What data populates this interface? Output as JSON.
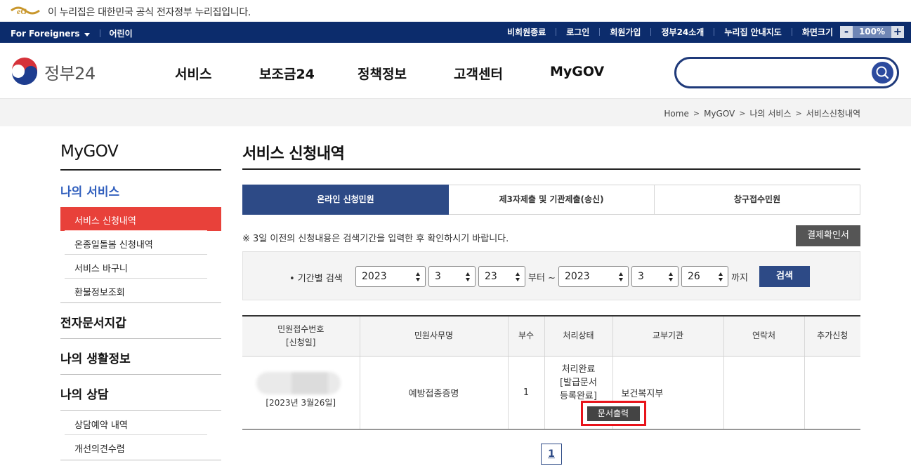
{
  "notice": {
    "text": "이 누리집은 대한민국 공식 전자정부 누리집입니다."
  },
  "utilbar": {
    "foreigners": "For Foreigners",
    "kids": "어린이",
    "links": [
      "비회원종료",
      "로그인",
      "회원가입",
      "정부24소개",
      "누리집 안내지도",
      "화면크기"
    ],
    "zoom_minus": "-",
    "zoom_value": "100%",
    "zoom_plus": "+"
  },
  "header": {
    "logo_text": "정부24",
    "gnb": [
      "서비스",
      "보조금24",
      "정책정보",
      "고객센터",
      "MyGOV"
    ],
    "search_placeholder": ""
  },
  "breadcrumb": [
    "Home",
    "MyGOV",
    "나의 서비스",
    "서비스신청내역"
  ],
  "sidebar": {
    "title": "MyGOV",
    "section1": "나의 서비스",
    "section1_items": [
      "서비스 신청내역",
      "온종일돌봄 신청내역",
      "서비스 바구니",
      "환불정보조회"
    ],
    "sections": [
      "전자문서지갑",
      "나의 생활정보",
      "나의 상담"
    ],
    "section4_items": [
      "상담예약 내역",
      "개선의견수렴"
    ]
  },
  "main": {
    "title": "서비스 신청내역",
    "tabs": [
      "온라인 신청민원",
      "제3자제출 및 기관제출(송신)",
      "창구접수민원"
    ],
    "note": "※ 3일 이전의 신청내용은 검색기간을 입력한 후 확인하시기 바랍니다.",
    "receipt_button": "결제확인서",
    "search": {
      "label": "• 기간별 검색",
      "from_year": "2023",
      "from_month": "3",
      "from_day": "23",
      "from_text": "부터 ~",
      "to_year": "2023",
      "to_month": "3",
      "to_day": "26",
      "to_text": "까지",
      "button": "검색"
    },
    "table": {
      "headers": [
        "민원접수번호\n[신청일]",
        "민원사무명",
        "부수",
        "처리상태",
        "교부기관",
        "연락처",
        "추가신청"
      ],
      "header_line1": "민원접수번호",
      "header_line2": "[신청일]",
      "rows": [
        {
          "date": "[2023년 3월26일]",
          "name": "예방접종증명",
          "copies": "1",
          "status1": "처리완료",
          "status2": "[발급문서",
          "status3": "등록완료]",
          "print_button": "문서출력",
          "agency": "보건복지부",
          "contact": "",
          "extra": ""
        }
      ]
    },
    "page": "1"
  },
  "colors": {
    "navy": "#0c2c6c",
    "active_tab": "#2d4a86",
    "sidebar_active": "#e8413a",
    "highlight": "#e8141b"
  }
}
